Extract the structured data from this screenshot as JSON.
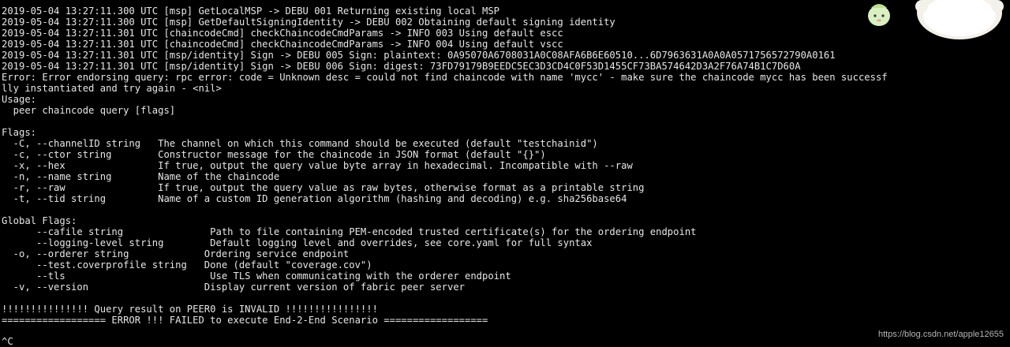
{
  "terminal": {
    "lines": [
      "2019-05-04 13:27:11.300 UTC [msp] GetLocalMSP -> DEBU 001 Returning existing local MSP",
      "2019-05-04 13:27:11.300 UTC [msp] GetDefaultSigningIdentity -> DEBU 002 Obtaining default signing identity",
      "2019-05-04 13:27:11.301 UTC [chaincodeCmd] checkChaincodeCmdParams -> INFO 003 Using default escc",
      "2019-05-04 13:27:11.301 UTC [chaincodeCmd] checkChaincodeCmdParams -> INFO 004 Using default vscc",
      "2019-05-04 13:27:11.301 UTC [msp/identity] Sign -> DEBU 005 Sign: plaintext: 0A95070A6708031A0C08AFA6B6E60510...6D7963631A0A0A0571756572790A0161",
      "2019-05-04 13:27:11.301 UTC [msp/identity] Sign -> DEBU 006 Sign: digest: 73FD79179B9EEDC5EC3D3CD4C0F53D1455CF73BA574642D3A2F76A74B1C7D60A",
      "Error: Error endorsing query: rpc error: code = Unknown desc = could not find chaincode with name 'mycc' - make sure the chaincode mycc has been successf",
      "lly instantiated and try again - <nil>",
      "Usage:",
      "  peer chaincode query [flags]",
      "",
      "Flags:",
      "  -C, --channelID string   The channel on which this command should be executed (default \"testchainid\")",
      "  -c, --ctor string        Constructor message for the chaincode in JSON format (default \"{}\")",
      "  -x, --hex                If true, output the query value byte array in hexadecimal. Incompatible with --raw",
      "  -n, --name string        Name of the chaincode",
      "  -r, --raw                If true, output the query value as raw bytes, otherwise format as a printable string",
      "  -t, --tid string         Name of a custom ID generation algorithm (hashing and decoding) e.g. sha256base64",
      "",
      "Global Flags:",
      "      --cafile string               Path to file containing PEM-encoded trusted certificate(s) for the ordering endpoint",
      "      --logging-level string        Default logging level and overrides, see core.yaml for full syntax",
      "  -o, --orderer string             Ordering service endpoint",
      "      --test.coverprofile string   Done (default \"coverage.cov\")",
      "      --tls                         Use TLS when communicating with the orderer endpoint",
      "  -v, --version                    Display current version of fabric peer server",
      "",
      "!!!!!!!!!!!!!!! Query result on PEER0 is INVALID !!!!!!!!!!!!!!!!",
      "================== ERROR !!! FAILED to execute End-2-End Scenario =================="
    ],
    "prompt": "^C"
  },
  "watermark": "https://blog.csdn.net/apple12655",
  "colors": {
    "background": "#000000",
    "text": "#e6e6e6"
  }
}
